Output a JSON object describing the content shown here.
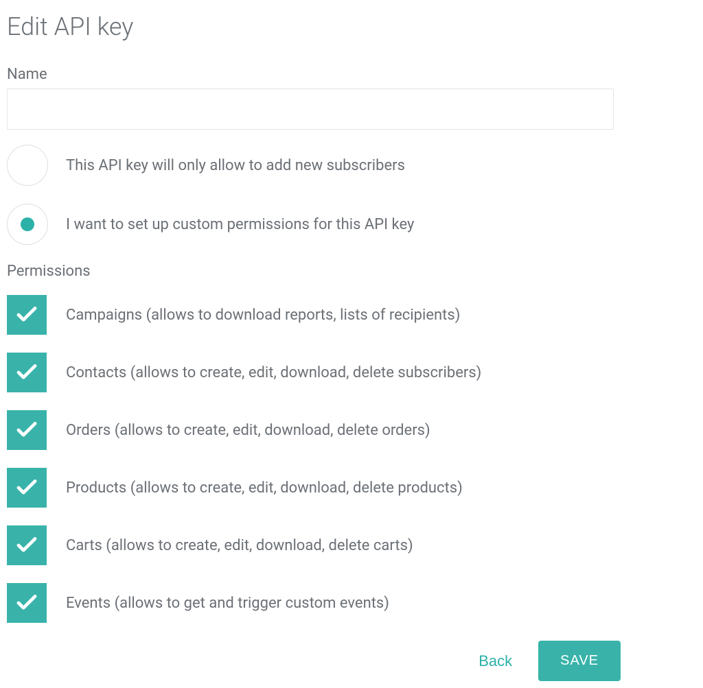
{
  "page_title": "Edit API key",
  "name_field": {
    "label": "Name",
    "value": ""
  },
  "radio_options": [
    {
      "label": "This API key will only allow to add new subscribers",
      "checked": false
    },
    {
      "label": "I want to set up custom permissions for this API key",
      "checked": true
    }
  ],
  "permissions_label": "Permissions",
  "permissions": [
    {
      "label": "Campaigns (allows to download reports, lists of recipients)",
      "checked": true
    },
    {
      "label": "Contacts (allows to create, edit, download, delete subscribers)",
      "checked": true
    },
    {
      "label": "Orders (allows to create, edit, download, delete orders)",
      "checked": true
    },
    {
      "label": "Products (allows to create, edit, download, delete products)",
      "checked": true
    },
    {
      "label": "Carts (allows to create, edit, download, delete carts)",
      "checked": true
    },
    {
      "label": "Events (allows to get and trigger custom events)",
      "checked": true
    }
  ],
  "buttons": {
    "back": "Back",
    "save": "SAVE"
  },
  "colors": {
    "accent": "#39b3aa"
  }
}
